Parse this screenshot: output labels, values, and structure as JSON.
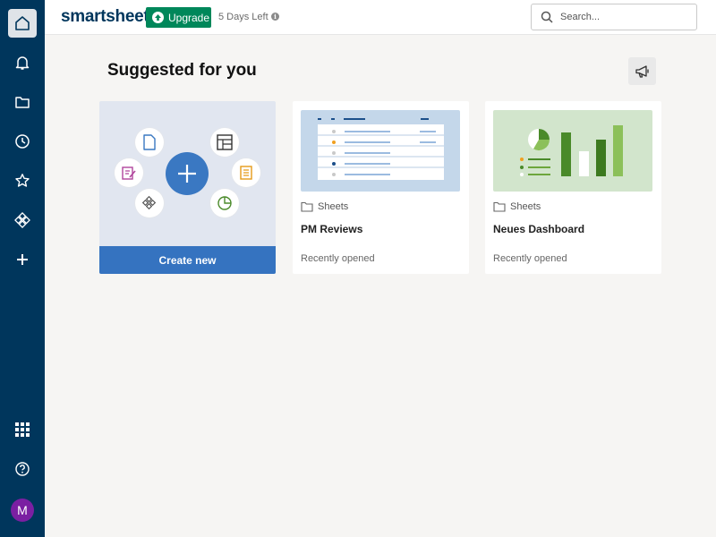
{
  "brand": {
    "logo": "smartsheet",
    "accent": "#00365c",
    "upgrade_color": "#00875a"
  },
  "sidebar": {
    "items": [
      {
        "name": "home-icon",
        "active": true
      },
      {
        "name": "bell-icon"
      },
      {
        "name": "folder-icon"
      },
      {
        "name": "clock-icon"
      },
      {
        "name": "star-icon"
      },
      {
        "name": "workapps-icon"
      },
      {
        "name": "plus-icon"
      },
      {
        "name": "grid-icon"
      },
      {
        "name": "help-icon"
      }
    ],
    "avatar_initial": "M"
  },
  "header": {
    "upgrade_label": "Upgrade",
    "trial_text": "5 Days Left",
    "search_placeholder": "Search..."
  },
  "main": {
    "title": "Suggested for you",
    "create_card": {
      "button_label": "Create new"
    },
    "cards": [
      {
        "type": "Sheets",
        "title": "PM Reviews",
        "subtitle": "Recently opened"
      },
      {
        "type": "Sheets",
        "title": "Neues Dashboard",
        "subtitle": "Recently opened"
      }
    ]
  }
}
